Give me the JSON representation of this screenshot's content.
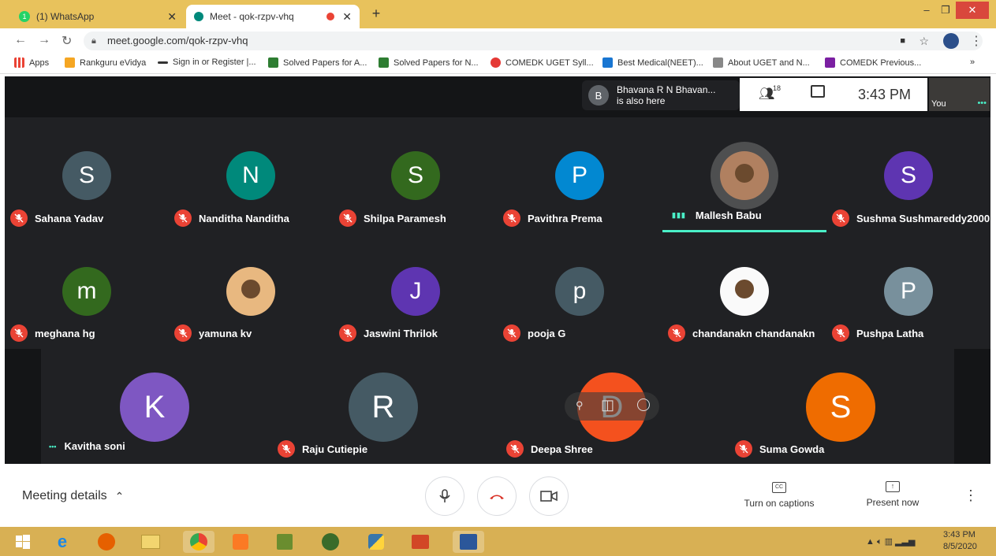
{
  "tabs": [
    {
      "badge": "1",
      "label": "(1) WhatsApp"
    },
    {
      "label": "Meet - qok-rzpv-vhq"
    }
  ],
  "window": {
    "minimize": "–",
    "restore": "❐",
    "close": "✕",
    "new_tab": "+"
  },
  "address": {
    "url": "meet.google.com/qok-rzpv-vhq"
  },
  "bookmarks": [
    "Apps",
    "Rankguru eVidya",
    "Sign in or Register |...",
    "Solved Papers for A...",
    "Solved Papers for N...",
    "COMEDK UGET Syll...",
    "Best Medical(NEET)...",
    "About UGET and N...",
    "COMEDK Previous..."
  ],
  "bookmarks_more": "»",
  "notification": {
    "avatar_letter": "B",
    "line1": "Bhavana R N Bhavan...",
    "line2": "is also here"
  },
  "meet_header": {
    "people_count": "18",
    "time": "3:43 PM",
    "self_label": "You"
  },
  "participants": [
    {
      "name": "Sahana Yadav",
      "letter": "S",
      "color": "#455a64",
      "muted": true
    },
    {
      "name": "Nanditha Nanditha",
      "letter": "N",
      "color": "#00897b",
      "muted": true
    },
    {
      "name": "Shilpa Paramesh",
      "letter": "S",
      "color": "#33691e",
      "muted": true
    },
    {
      "name": "Pavithra Prema",
      "letter": "P",
      "color": "#0288d1",
      "muted": true
    },
    {
      "name": "Mallesh Babu",
      "letter": "",
      "color": "#b08060",
      "muted": false,
      "speaking": true
    },
    {
      "name": "Sushma Sushmareddy2000",
      "letter": "S",
      "color": "#5e35b1",
      "muted": true
    },
    {
      "name": "meghana hg",
      "letter": "m",
      "color": "#33691e",
      "muted": true
    },
    {
      "name": "yamuna kv",
      "letter": "",
      "color": "#e8b880",
      "muted": true
    },
    {
      "name": "Jaswini Thrilok",
      "letter": "J",
      "color": "#5e35b1",
      "muted": true
    },
    {
      "name": "pooja G",
      "letter": "p",
      "color": "#455a64",
      "muted": true
    },
    {
      "name": "chandanakn chandanakn",
      "letter": "",
      "color": "#fafafa",
      "muted": true
    },
    {
      "name": "Pushpa Latha",
      "letter": "P",
      "color": "#78909c",
      "muted": true
    },
    {
      "name": "Kavitha soni",
      "letter": "K",
      "color": "#7e57c2",
      "muted": false
    },
    {
      "name": "Raju Cutiepie",
      "letter": "R",
      "color": "#455a64",
      "muted": true
    },
    {
      "name": "Deepa Shree",
      "letter": "D",
      "color": "#f4511e",
      "muted": true
    },
    {
      "name": "Suma Gowda",
      "letter": "S",
      "color": "#ef6c00",
      "muted": true
    }
  ],
  "bottom": {
    "meeting_details": "Meeting details",
    "captions": "Turn on captions",
    "present": "Present now"
  },
  "taskbar": {
    "time": "3:43 PM",
    "date": "8/5/2020"
  }
}
